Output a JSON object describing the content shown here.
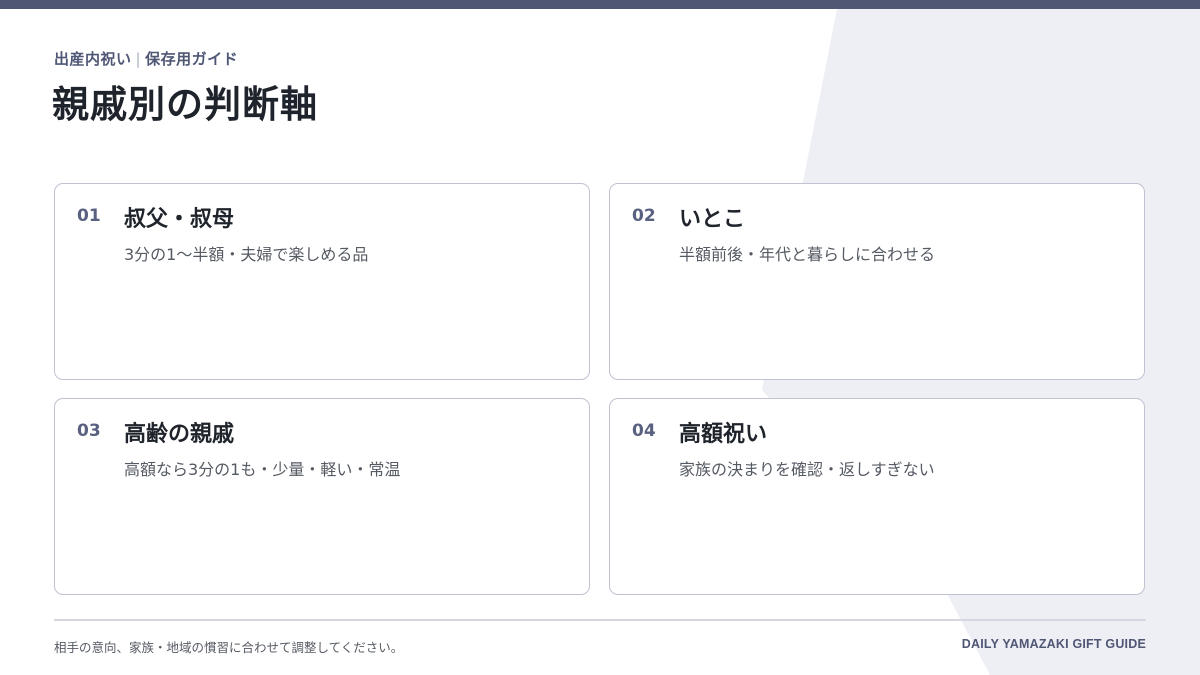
{
  "header": {
    "category": "出産内祝い",
    "separator": "|",
    "subcategory": "保存用ガイド",
    "title": "親戚別の判断軸"
  },
  "cards": [
    {
      "number": "01",
      "title": "叔父・叔母",
      "description": "3分の1〜半額・夫婦で楽しめる品"
    },
    {
      "number": "02",
      "title": "いとこ",
      "description": "半額前後・年代と暮らしに合わせる"
    },
    {
      "number": "03",
      "title": "高齢の親戚",
      "description": "高額なら3分の1も・少量・軽い・常温"
    },
    {
      "number": "04",
      "title": "高額祝い",
      "description": "家族の決まりを確認・返しすぎない"
    }
  ],
  "footer": {
    "note": "相手の意向、家族・地域の慣習に合わせて調整してください。",
    "brand": "DAILY YAMAZAKI GIFT GUIDE"
  },
  "colors": {
    "accent": "#4f5775",
    "background_shape": "#eeeff5",
    "card_border": "#bfc3d1"
  }
}
